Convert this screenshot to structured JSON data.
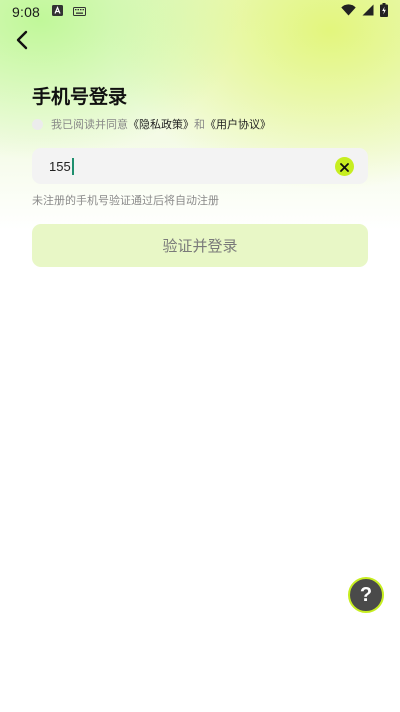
{
  "status_bar": {
    "time": "9:08",
    "left_icons": [
      "text-a-icon",
      "keyboard-icon"
    ],
    "right_icons": [
      "wifi-icon",
      "signal-icon",
      "battery-charging-icon"
    ]
  },
  "header": {
    "back_icon": "chevron-left-icon",
    "title": "手机号登录"
  },
  "agreement": {
    "prefix": "我已阅读并同意",
    "privacy_link": "《隐私政策》",
    "conjunction": "和",
    "user_link": "《用户协议》",
    "checked": false
  },
  "phone": {
    "value": "155",
    "clear_icon": "close-circle-icon"
  },
  "hint": "未注册的手机号验证通过后将自动注册",
  "login_button": "验证并登录",
  "help": {
    "label": "?",
    "icon": "help-icon"
  },
  "colors": {
    "accent": "#c7ee20",
    "button_bg": "#e8f7c6",
    "input_bg": "#f3f3f3",
    "caret": "#1f8f6e"
  }
}
